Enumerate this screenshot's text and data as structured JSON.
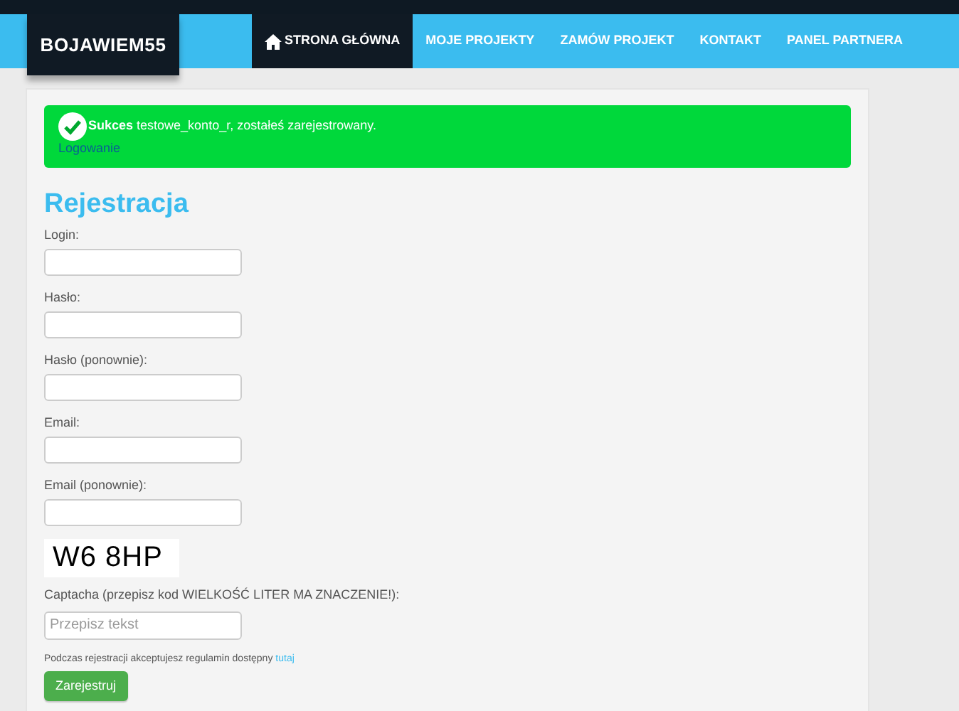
{
  "logo": "BOJAWIEM55",
  "nav": [
    {
      "label": "STRONA GŁÓWNA",
      "selected": true,
      "kind": "home"
    },
    {
      "label": "MOJE PROJEKTY",
      "selected": false,
      "kind": "page"
    },
    {
      "label": "ZAMÓW PROJEKT",
      "selected": false,
      "kind": "page"
    },
    {
      "label": "KONTAKT",
      "selected": false,
      "kind": "page"
    },
    {
      "label": "PANEL PARTNERA",
      "selected": false,
      "kind": "page"
    }
  ],
  "alert": {
    "message": "**Sukces** testowe_konto_r, zostałeś zarejestrowany.",
    "link": "Logowanie"
  },
  "heading": "Rejestracja",
  "fields": [
    {
      "label": "Login:"
    },
    {
      "label": "Hasło:"
    },
    {
      "label": "Hasło (ponownie):"
    },
    {
      "label": "Email:"
    },
    {
      "label": "Email (ponownie):"
    }
  ],
  "captcha": {
    "image_text": "W6 8HP",
    "label": "Captacha (przepisz kod WIELKOŚĆ LITER MA ZNACZENIE!):",
    "placeholder": "Przepisz tekst"
  },
  "terms": {
    "text": "Podczas rejestracji akceptujesz regulamin dostępny",
    "link": "tutaj"
  },
  "submit": "Zarejestruj"
}
